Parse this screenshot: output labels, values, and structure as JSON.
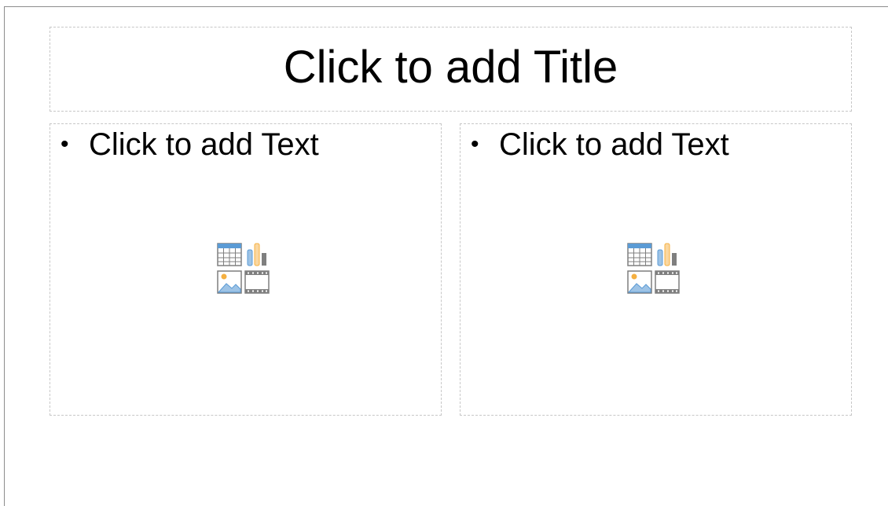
{
  "slide": {
    "title_placeholder": "Click to add Title",
    "content_left": {
      "bullet": "•",
      "text_placeholder": "Click to add Text",
      "insert_icons": [
        "insert-table-icon",
        "insert-chart-icon",
        "insert-image-icon",
        "insert-video-icon"
      ]
    },
    "content_right": {
      "bullet": "•",
      "text_placeholder": "Click to add Text",
      "insert_icons": [
        "insert-table-icon",
        "insert-chart-icon",
        "insert-image-icon",
        "insert-video-icon"
      ]
    }
  },
  "colors": {
    "placeholder_border": "#c7c7c7",
    "slide_border": "#8c8c8c",
    "icon_blue": "#5b9bd5",
    "icon_orange": "#f5b041",
    "icon_gray": "#7f7f7f"
  }
}
